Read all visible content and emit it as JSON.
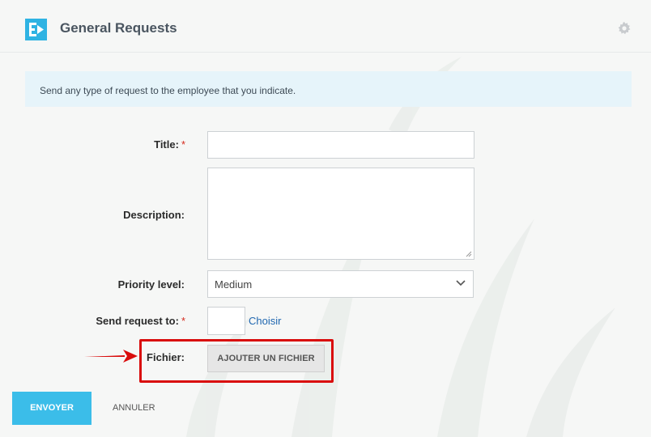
{
  "header": {
    "title": "General Requests",
    "logo_icon": "bizapp-logo-icon",
    "settings_icon": "gear-icon"
  },
  "banner": {
    "text": "Send any type of request to the employee that you indicate."
  },
  "form": {
    "title_label": "Title:",
    "title_value": "",
    "description_label": "Description:",
    "description_value": "",
    "priority_label": "Priority level:",
    "priority_value": "Medium",
    "send_to_label": "Send request to:",
    "choose_link": "Choisir",
    "file_label": "Fichier:",
    "add_file_button": "AJOUTER UN FICHIER",
    "required_mark": "*"
  },
  "actions": {
    "submit": "ENVOYER",
    "cancel": "ANNULER"
  },
  "colors": {
    "accent": "#3bbde9",
    "banner_bg": "#e6f4fa",
    "highlight": "#d90c0c",
    "link": "#2067b0",
    "required": "#d52b1e"
  }
}
